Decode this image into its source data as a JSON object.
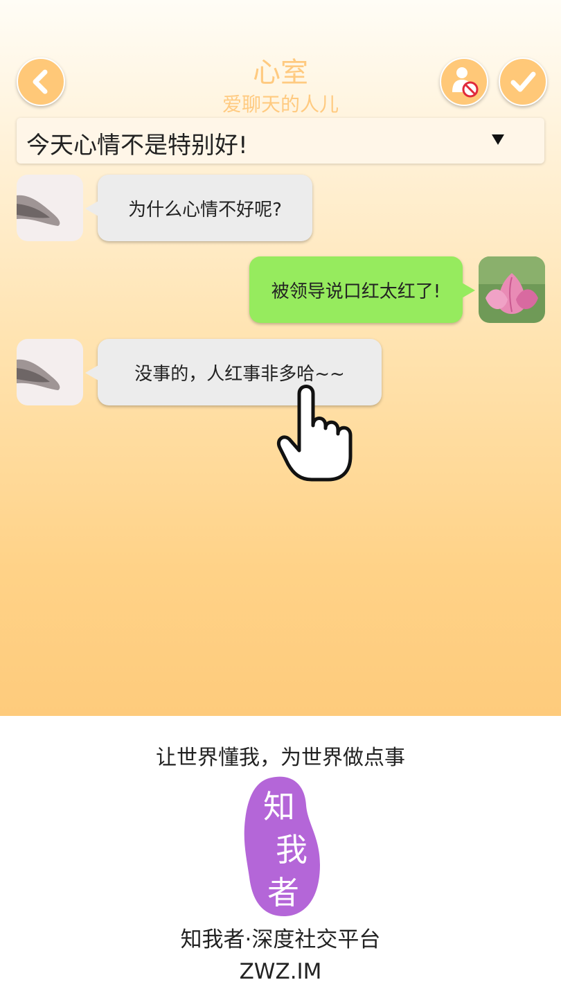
{
  "header": {
    "title": "心室",
    "subtitle": "爱聊天的人儿",
    "back_icon": "chevron-left-icon",
    "block_icon": "user-blocked-icon",
    "confirm_icon": "check-icon"
  },
  "mood_select": {
    "value": "今天心情不是特别好!"
  },
  "messages": [
    {
      "side": "left",
      "text": "为什么心情不好呢?"
    },
    {
      "side": "right",
      "text": "被领导说口红太红了!"
    },
    {
      "side": "left",
      "text": "没事的，人红事非多哈~~"
    }
  ],
  "footer": {
    "slogan": "让世界懂我，为世界做点事",
    "logo_text": "知我者",
    "brand": "知我者·深度社交平台",
    "url": "ZWZ.IM"
  },
  "colors": {
    "accent": "#ffc878",
    "title": "#ffca80",
    "bubble_left": "#ececec",
    "bubble_right": "#96eb5e",
    "logo": "#b466d8"
  }
}
